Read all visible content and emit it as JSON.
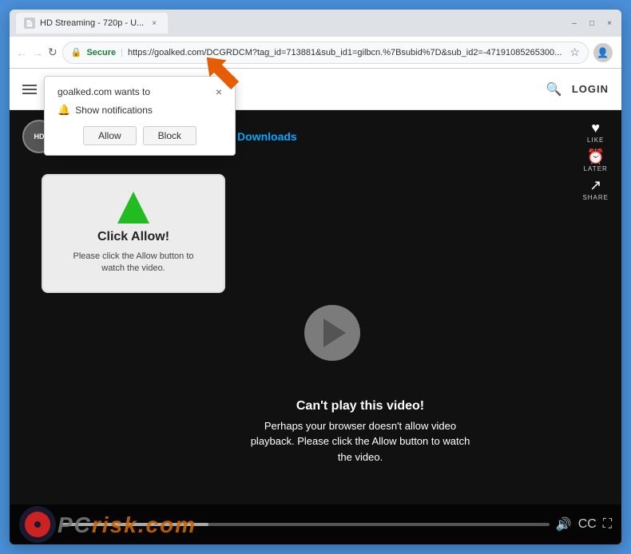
{
  "browser": {
    "tab_title": "HD Streaming - 720p - U...",
    "url_secure_label": "Secure",
    "url_full": "https://goalked.com/DCGRDCM?tag_id=713881&sub_id1=gilbcn.%7Bsubid%7D&sub_id2=-47191085265300...",
    "back_btn": "←",
    "forward_btn": "→",
    "refresh_btn": "↻"
  },
  "site": {
    "login_label": "LOGIN"
  },
  "popup": {
    "title": "goalked.com wants to",
    "notification_label": "Show notifications",
    "allow_btn": "Allow",
    "block_btn": "Block",
    "close_btn": "×"
  },
  "video": {
    "title": "HD Streaming - 720p - Unlimited Downloads",
    "hd_badge": "HD",
    "like_label": "LIKE",
    "later_label": "LATER",
    "share_label": "SHARE",
    "click_allow_title": "Click Allow!",
    "click_allow_desc": "Please click the Allow button to watch the video.",
    "cant_play_title": "Can't play this video!",
    "cant_play_desc": "Perhaps your browser doesn't allow video playback. Please click the Allow button to watch the video."
  },
  "watermark": {
    "prefix": "PC",
    "suffix": "risk.com"
  }
}
